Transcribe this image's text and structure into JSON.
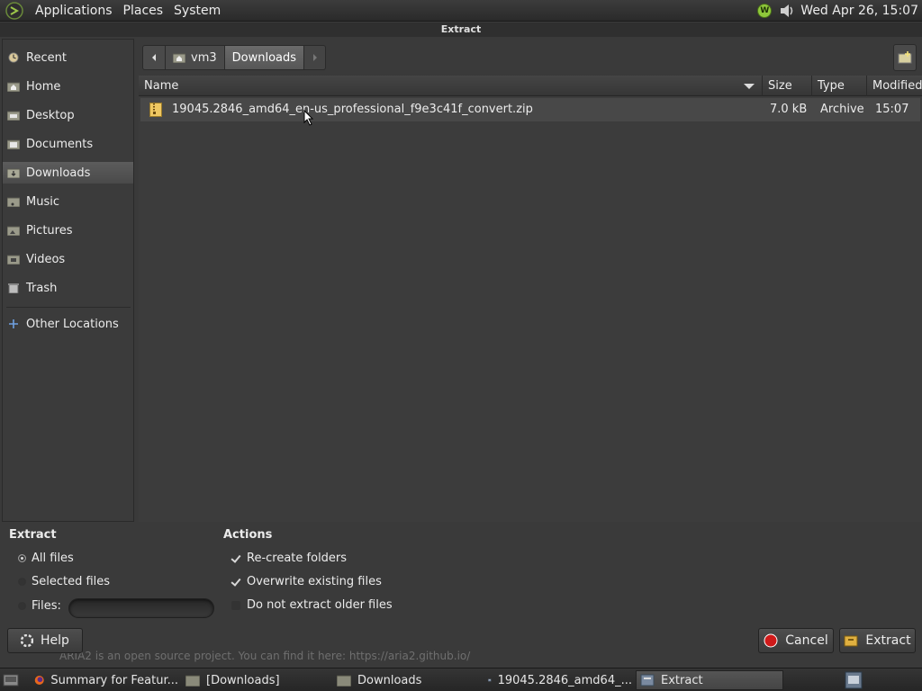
{
  "top_panel": {
    "menus": [
      "Applications",
      "Places",
      "System"
    ],
    "tray_w_label": "W",
    "clock": "Wed Apr 26, 15:07"
  },
  "dialog": {
    "title": "Extract"
  },
  "sidebar": {
    "items": [
      {
        "label": "Recent",
        "icon": "recent-icon"
      },
      {
        "label": "Home",
        "icon": "folder-home-icon"
      },
      {
        "label": "Desktop",
        "icon": "folder-icon"
      },
      {
        "label": "Documents",
        "icon": "folder-icon"
      },
      {
        "label": "Downloads",
        "icon": "folder-download-icon",
        "selected": true
      },
      {
        "label": "Music",
        "icon": "folder-icon"
      },
      {
        "label": "Pictures",
        "icon": "folder-icon"
      },
      {
        "label": "Videos",
        "icon": "folder-icon"
      },
      {
        "label": "Trash",
        "icon": "trash-icon"
      },
      {
        "label": "Other Locations",
        "icon": "plus-icon"
      }
    ]
  },
  "pathbar": {
    "segments": [
      "vm3",
      "Downloads"
    ],
    "active": "Downloads"
  },
  "file_list": {
    "columns": [
      "Name",
      "Size",
      "Type",
      "Modified"
    ],
    "rows": [
      {
        "name": "19045.2846_amd64_en-us_professional_f9e3c41f_convert.zip",
        "size": "7.0 kB",
        "type": "Archive",
        "modified": "15:07"
      }
    ]
  },
  "extract_options": {
    "heading": "Extract",
    "all_files": "All files",
    "selected_files": "Selected files",
    "files": "Files:",
    "files_value": ""
  },
  "actions": {
    "heading": "Actions",
    "recreate": "Re-create folders",
    "overwrite": "Overwrite existing files",
    "no_older": "Do not extract older files"
  },
  "buttons": {
    "help": "Help",
    "cancel": "Cancel",
    "extract": "Extract"
  },
  "underlay": {
    "text": "ARIA2 is an open source project. You can find it here: https://aria2.github.io/"
  },
  "taskbar": {
    "items": [
      "Summary for Featur...",
      "[Downloads]",
      "Downloads",
      "19045.2846_amd64_...",
      "Extract"
    ]
  },
  "colors": {
    "accent_green": "#8fc83b",
    "cancel_red": "#d01a1a",
    "selection": "#5a5a5a"
  }
}
